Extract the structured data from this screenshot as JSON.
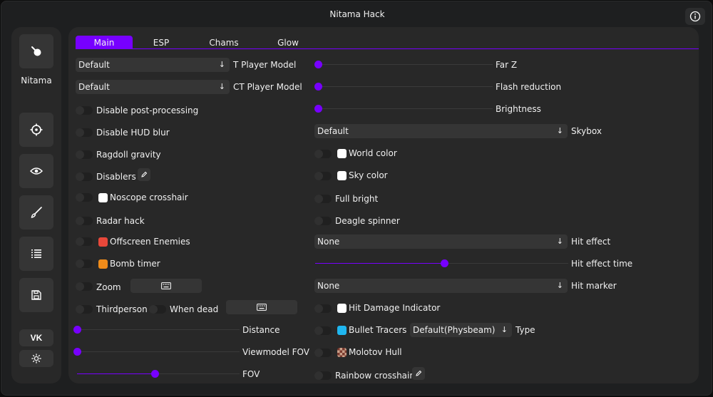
{
  "window": {
    "title": "Nitama Hack"
  },
  "sidebar": {
    "brand": "Nitama",
    "buttons": [
      {
        "icon": "logo-icon"
      },
      {
        "icon": "crosshair-icon"
      },
      {
        "icon": "eye-icon"
      },
      {
        "icon": "brush-icon"
      },
      {
        "icon": "list-icon"
      },
      {
        "icon": "save-icon"
      },
      {
        "icon": "vk-icon",
        "label": "VK"
      },
      {
        "icon": "sun-icon"
      }
    ]
  },
  "tabs": [
    "Main",
    "ESP",
    "Chams",
    "Glow"
  ],
  "left": {
    "t_model": {
      "value": "Default",
      "label": "T Player Model"
    },
    "ct_model": {
      "value": "Default",
      "label": "CT Player Model"
    },
    "disable_post": "Disable post-processing",
    "disable_hud_blur": "Disable HUD blur",
    "ragdoll": "Ragdoll gravity",
    "disablers": "Disablers",
    "noscope": "Noscope crosshair",
    "radar": "Radar hack",
    "offscreen": "Offscreen Enemies",
    "bomb_timer": "Bomb timer",
    "zoom": "Zoom",
    "thirdperson": "Thirdperson",
    "when_dead": "When dead",
    "distance": {
      "label": "Distance",
      "value": 0
    },
    "viewmodel_fov": {
      "label": "Viewmodel FOV",
      "value": 0
    },
    "fov": {
      "label": "FOV",
      "value": 0.48
    }
  },
  "right": {
    "far_z": {
      "label": "Far Z",
      "value": 0
    },
    "flash": {
      "label": "Flash reduction",
      "value": 0
    },
    "brightness": {
      "label": "Brightness",
      "value": 0
    },
    "skybox": {
      "value": "Default",
      "label": "Skybox"
    },
    "world_color": "World color",
    "sky_color": "Sky color",
    "full_bright": "Full bright",
    "deagle": "Deagle spinner",
    "hit_effect": {
      "value": "None",
      "label": "Hit effect"
    },
    "hit_effect_time": {
      "label": "Hit effect time",
      "value": 0.51
    },
    "hit_marker": {
      "value": "None",
      "label": "Hit marker"
    },
    "hit_damage": "Hit Damage Indicator",
    "bullet_tracers": "Bullet Tracers",
    "tracer_type": {
      "value": "Default(Physbeam)",
      "label": "Type"
    },
    "molotov": "Molotov Hull",
    "rainbow": "Rainbow crosshair"
  },
  "colors": {
    "accent": "#7700ff",
    "offscreen": "#e8483a",
    "bomb": "#f08c1a",
    "white": "#ffffff",
    "tracer": "#1fb6ef"
  }
}
